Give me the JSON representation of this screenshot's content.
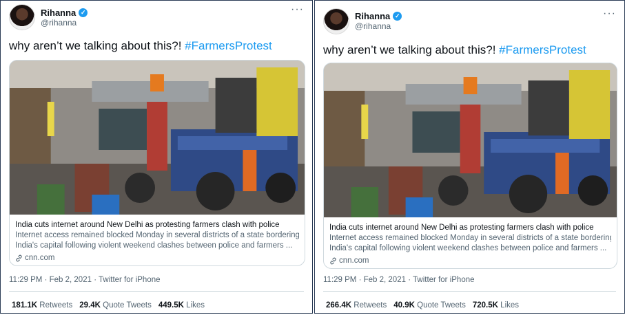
{
  "tweets": [
    {
      "name": "Rihanna",
      "handle": "@rihanna",
      "text": "why aren’t we talking about this?! ",
      "hashtag": "#FarmersProtest",
      "card": {
        "title": "India cuts internet around New Delhi as protesting farmers clash with police",
        "desc1": "Internet access remained blocked Monday in several districts of a state bordering",
        "desc2": "India's capital following violent weekend clashes between police and farmers ...",
        "domain": "cnn.com"
      },
      "time": "11:29 PM",
      "date": "Feb 2, 2021",
      "source": "Twitter for iPhone",
      "retweets": "181.1K",
      "retweets_label": "Retweets",
      "quotes": "29.4K",
      "quotes_label": "Quote Tweets",
      "likes": "449.5K",
      "likes_label": "Likes"
    },
    {
      "name": "Rihanna",
      "handle": "@rihanna",
      "text": "why aren’t we talking about this?! ",
      "hashtag": "#FarmersProtest",
      "card": {
        "title": "India cuts internet around New Delhi as protesting farmers clash with police",
        "desc1": "Internet access remained blocked Monday in several districts of a state bordering",
        "desc2": "India's capital following violent weekend clashes between police and farmers ...",
        "domain": "cnn.com"
      },
      "time": "11:29 PM",
      "date": "Feb 2, 2021",
      "source": "Twitter for iPhone",
      "retweets": "266.4K",
      "retweets_label": "Retweets",
      "quotes": "40.9K",
      "quotes_label": "Quote Tweets",
      "likes": "720.5K",
      "likes_label": "Likes"
    }
  ],
  "icons": {
    "verified": "verified-badge-icon",
    "more": "more-options-icon",
    "link": "link-icon"
  },
  "colors": {
    "accent": "#1d9bf0",
    "text": "#0f1419",
    "muted": "#536471"
  }
}
